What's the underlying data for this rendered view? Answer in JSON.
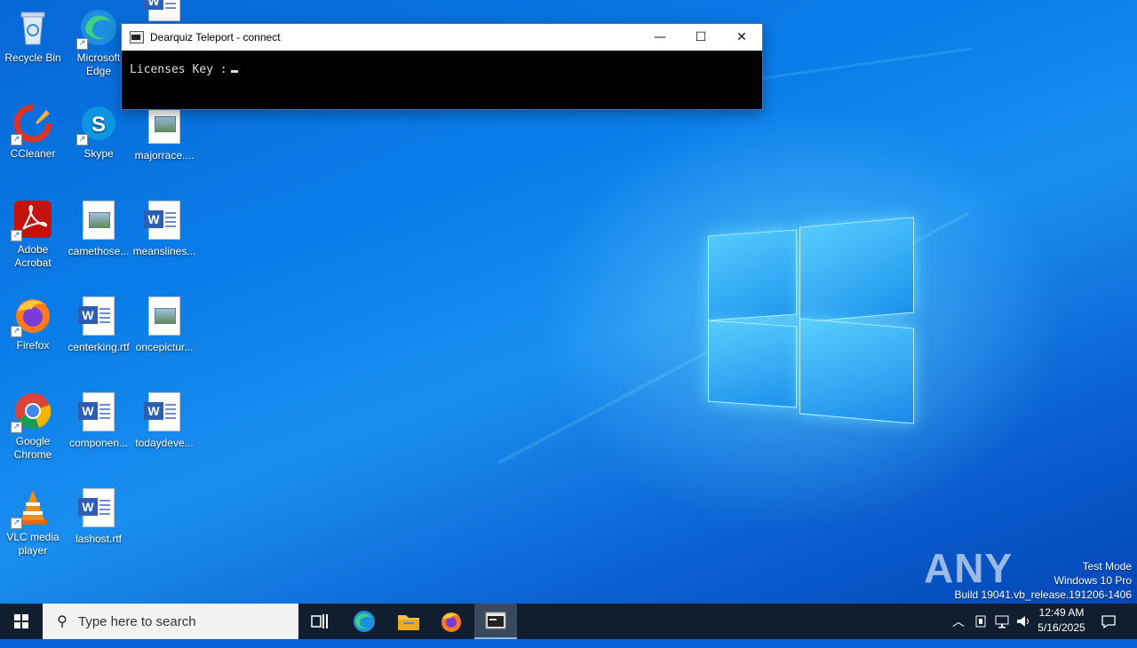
{
  "desktop": {
    "icons": [
      {
        "label": "Recycle Bin",
        "icon": "recycle-bin-icon"
      },
      {
        "label": "Microsoft Edge",
        "icon": "edge-icon"
      },
      {
        "label": "CCleaner",
        "icon": "ccleaner-icon"
      },
      {
        "label": "Skype",
        "icon": "skype-icon"
      },
      {
        "label": "majorrace....",
        "icon": "image-file-icon"
      },
      {
        "label": "Adobe Acrobat",
        "icon": "acrobat-icon"
      },
      {
        "label": "camethose...",
        "icon": "image-file-icon"
      },
      {
        "label": "meanslines...",
        "icon": "word-doc-icon"
      },
      {
        "label": "Firefox",
        "icon": "firefox-icon"
      },
      {
        "label": "centerking.rtf",
        "icon": "word-doc-icon"
      },
      {
        "label": "oncepictur...",
        "icon": "image-file-icon"
      },
      {
        "label": "Google Chrome",
        "icon": "chrome-icon"
      },
      {
        "label": "componen...",
        "icon": "word-doc-icon"
      },
      {
        "label": "todaydeve...",
        "icon": "word-doc-icon"
      },
      {
        "label": "VLC media player",
        "icon": "vlc-icon"
      },
      {
        "label": "lashost.rtf",
        "icon": "word-doc-icon"
      }
    ]
  },
  "console": {
    "title": "Dearquiz Teleport - connect",
    "prompt": "Licenses Key :",
    "controls": {
      "minimize": "—",
      "maximize": "☐",
      "close": "✕"
    }
  },
  "watermark": {
    "logo": "ANY RUN",
    "line1": "Test Mode",
    "line2": "Windows 10 Pro",
    "line3": "Build 19041.vb_release.191206-1406"
  },
  "taskbar": {
    "search_placeholder": "Type here to search",
    "clock_time": "12:49 AM",
    "clock_date": "5/16/2025"
  },
  "colors": {
    "accent": "#0a63d8",
    "taskbar": "#101e30",
    "console_bg": "#000000"
  }
}
